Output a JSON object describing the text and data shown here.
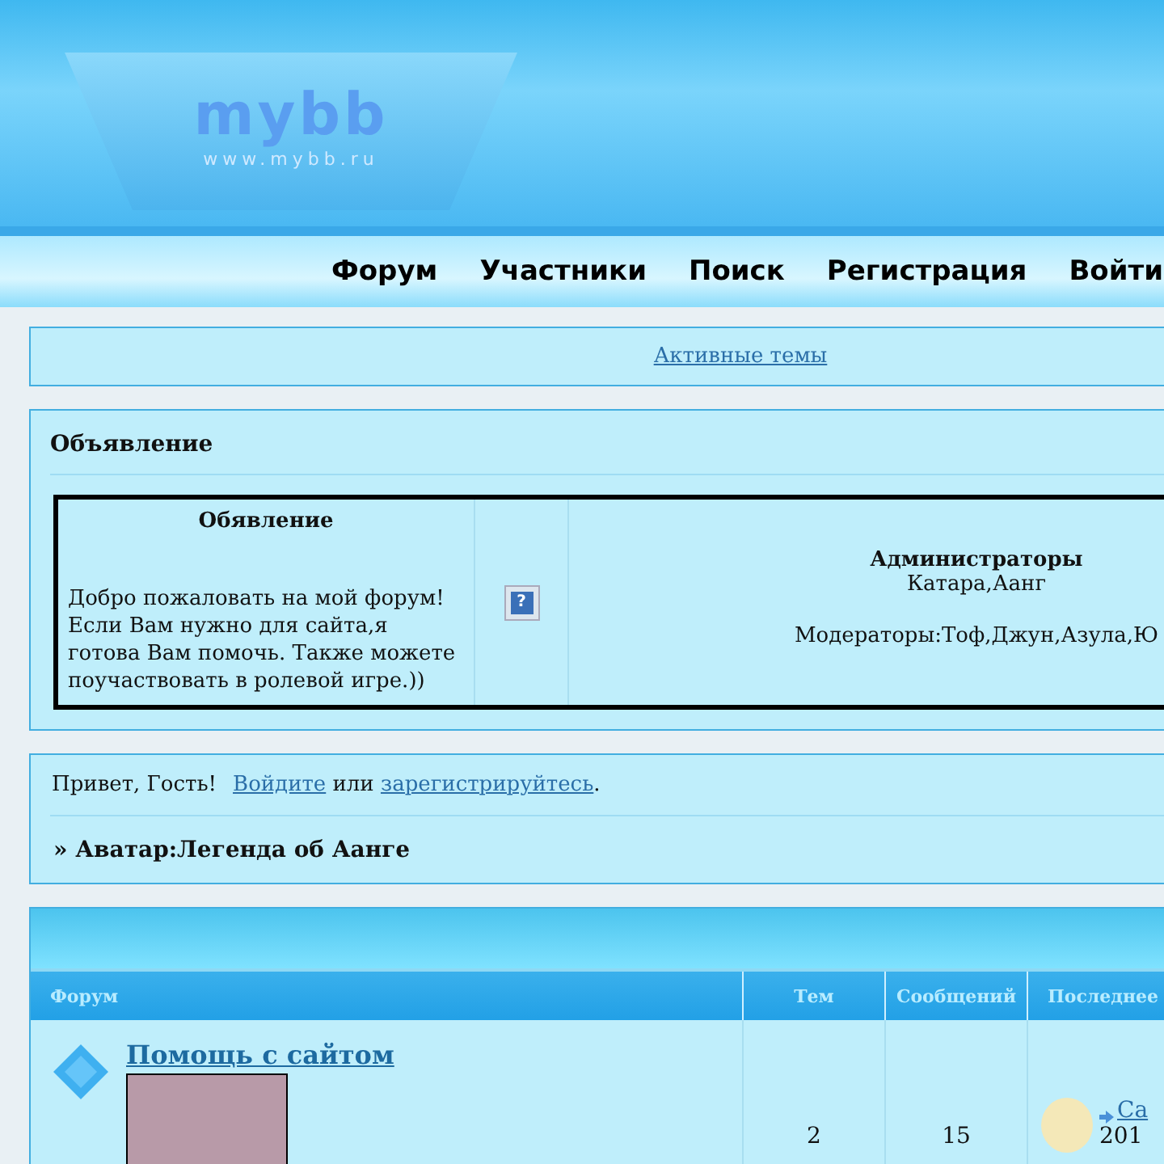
{
  "logo": {
    "name": "mybb",
    "url": "www.mybb.ru"
  },
  "nav": [
    {
      "label": "Форум"
    },
    {
      "label": "Участники"
    },
    {
      "label": "Поиск"
    },
    {
      "label": "Регистрация"
    },
    {
      "label": "Войти"
    }
  ],
  "active_topics": "Активные темы",
  "announcement": {
    "title": "Объявление",
    "help_icon": "?",
    "heading": "Обявление",
    "text": "Добро пожаловать на мой форум! Если Вам нужно для сайта,я готова Вам помочь. Также можете поучаствовать в ролевой игре.))",
    "admins_title": "Администраторы",
    "admins": "Катара,Аанг",
    "moderators": "Модераторы:Тоф,Джун,Азула,Ю"
  },
  "welcome": {
    "greeting": "Привет, Гость!",
    "login": "Войдите",
    "or": "или",
    "register": "зарегистрируйтесь",
    "end": "."
  },
  "board_title": "» Аватар:Легенда об Аанге",
  "table": {
    "columns": [
      "Форум",
      "Тем",
      "Сообщений",
      "Последнее"
    ],
    "rows": [
      {
        "title": "Помощь с сайтом",
        "topics": "2",
        "posts": "15",
        "last_link": "Са",
        "last_date": "201"
      }
    ]
  }
}
